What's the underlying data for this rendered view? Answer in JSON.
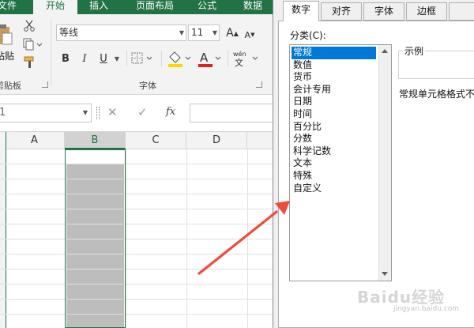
{
  "ribbon": {
    "tabs": [
      {
        "label": "文件",
        "active": false
      },
      {
        "label": "开始",
        "active": true
      },
      {
        "label": "插入",
        "active": false
      },
      {
        "label": "页面布局",
        "active": false
      },
      {
        "label": "公式",
        "active": false
      },
      {
        "label": "数据",
        "active": false
      }
    ],
    "clipboard": {
      "paste_label": "粘贴",
      "group_label": "剪贴板"
    },
    "font": {
      "name": "等线",
      "size": "11",
      "bold": "B",
      "italic": "I",
      "underline": "U",
      "group_label": "字体",
      "grow": "A",
      "shrink": "A",
      "phonetic": "wén"
    }
  },
  "formula_bar": {
    "name_box": "1",
    "fx": "fx",
    "value": ""
  },
  "sheet": {
    "columns": [
      "A",
      "B",
      "C",
      "D"
    ],
    "selected_column": "B"
  },
  "dialog": {
    "tabs": [
      {
        "label": "数字",
        "active": true
      },
      {
        "label": "对齐",
        "active": false
      },
      {
        "label": "字体",
        "active": false
      },
      {
        "label": "边框",
        "active": false
      }
    ],
    "category_label": "分类(C):",
    "categories": [
      "常规",
      "数值",
      "货币",
      "会计专用",
      "日期",
      "时间",
      "百分比",
      "分数",
      "科学记数",
      "文本",
      "特殊",
      "自定义"
    ],
    "selected_category": "常规",
    "sample_label": "示例",
    "description": "常规单元格格式不包含任何特定的数字格式。"
  },
  "annotation": {
    "arrow_color": "#f04a3a"
  },
  "watermark": {
    "text": "Baidu经验",
    "sub": "jingyan.baidu.com"
  },
  "colors": {
    "excel_green": "#217346",
    "selection_blue": "#0078d7",
    "selected_fill": "#bdbdbd"
  }
}
